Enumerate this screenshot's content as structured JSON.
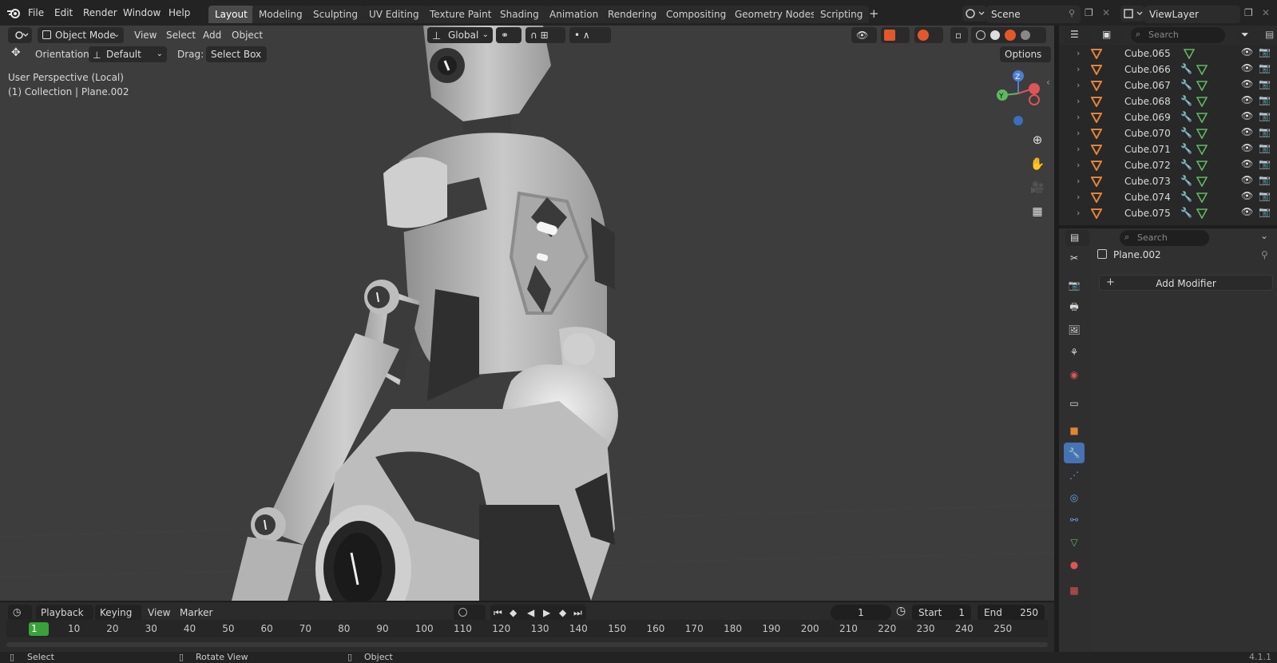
{
  "topbar": {
    "menus": [
      "File",
      "Edit",
      "Render",
      "Window",
      "Help"
    ],
    "workspaces": [
      "Layout",
      "Modeling",
      "Sculpting",
      "UV Editing",
      "Texture Paint",
      "Shading",
      "Animation",
      "Rendering",
      "Compositing",
      "Geometry Nodes",
      "Scripting"
    ],
    "active_workspace": "Layout",
    "scene": "Scene",
    "view_layer": "ViewLayer"
  },
  "viewport_header": {
    "mode": "Object Mode",
    "menus": [
      "View",
      "Select",
      "Add",
      "Object"
    ],
    "transform_orientation": "Global",
    "orientation_label": "Orientation:",
    "orientation_value": "Default",
    "drag_label": "Drag:",
    "drag_value": "Select Box",
    "options_label": "Options"
  },
  "viewport_overlay": {
    "perspective": "User Perspective (Local)",
    "collection": "(1) Collection | Plane.002",
    "gizmo_axes": [
      "Z",
      "Y"
    ]
  },
  "outliner": {
    "search_placeholder": "Search",
    "items": [
      "Cube.065",
      "Cube.066",
      "Cube.067",
      "Cube.068",
      "Cube.069",
      "Cube.070",
      "Cube.071",
      "Cube.072",
      "Cube.073",
      "Cube.074",
      "Cube.075"
    ]
  },
  "properties": {
    "search_placeholder": "Search",
    "object_name": "Plane.002",
    "add_modifier_label": "Add Modifier",
    "add_symbol": "+"
  },
  "timeline": {
    "menus": [
      "Playback",
      "Keying",
      "View",
      "Marker"
    ],
    "current_frame": "1",
    "start_label": "Start",
    "start_value": "1",
    "end_label": "End",
    "end_value": "250",
    "ruler": [
      "1",
      "10",
      "20",
      "30",
      "40",
      "50",
      "60",
      "70",
      "80",
      "90",
      "100",
      "110",
      "120",
      "130",
      "140",
      "150",
      "160",
      "170",
      "180",
      "190",
      "200",
      "210",
      "220",
      "230",
      "240",
      "250"
    ]
  },
  "statusbar": {
    "select": "Select",
    "rotate": "Rotate View",
    "object": "Object",
    "version": "4.1.1"
  },
  "colors": {
    "accent": "#4772b3",
    "mesh_icon": "#e2833a",
    "playhead": "#3aa23a",
    "viewport_bg": "#3d3d3d"
  }
}
